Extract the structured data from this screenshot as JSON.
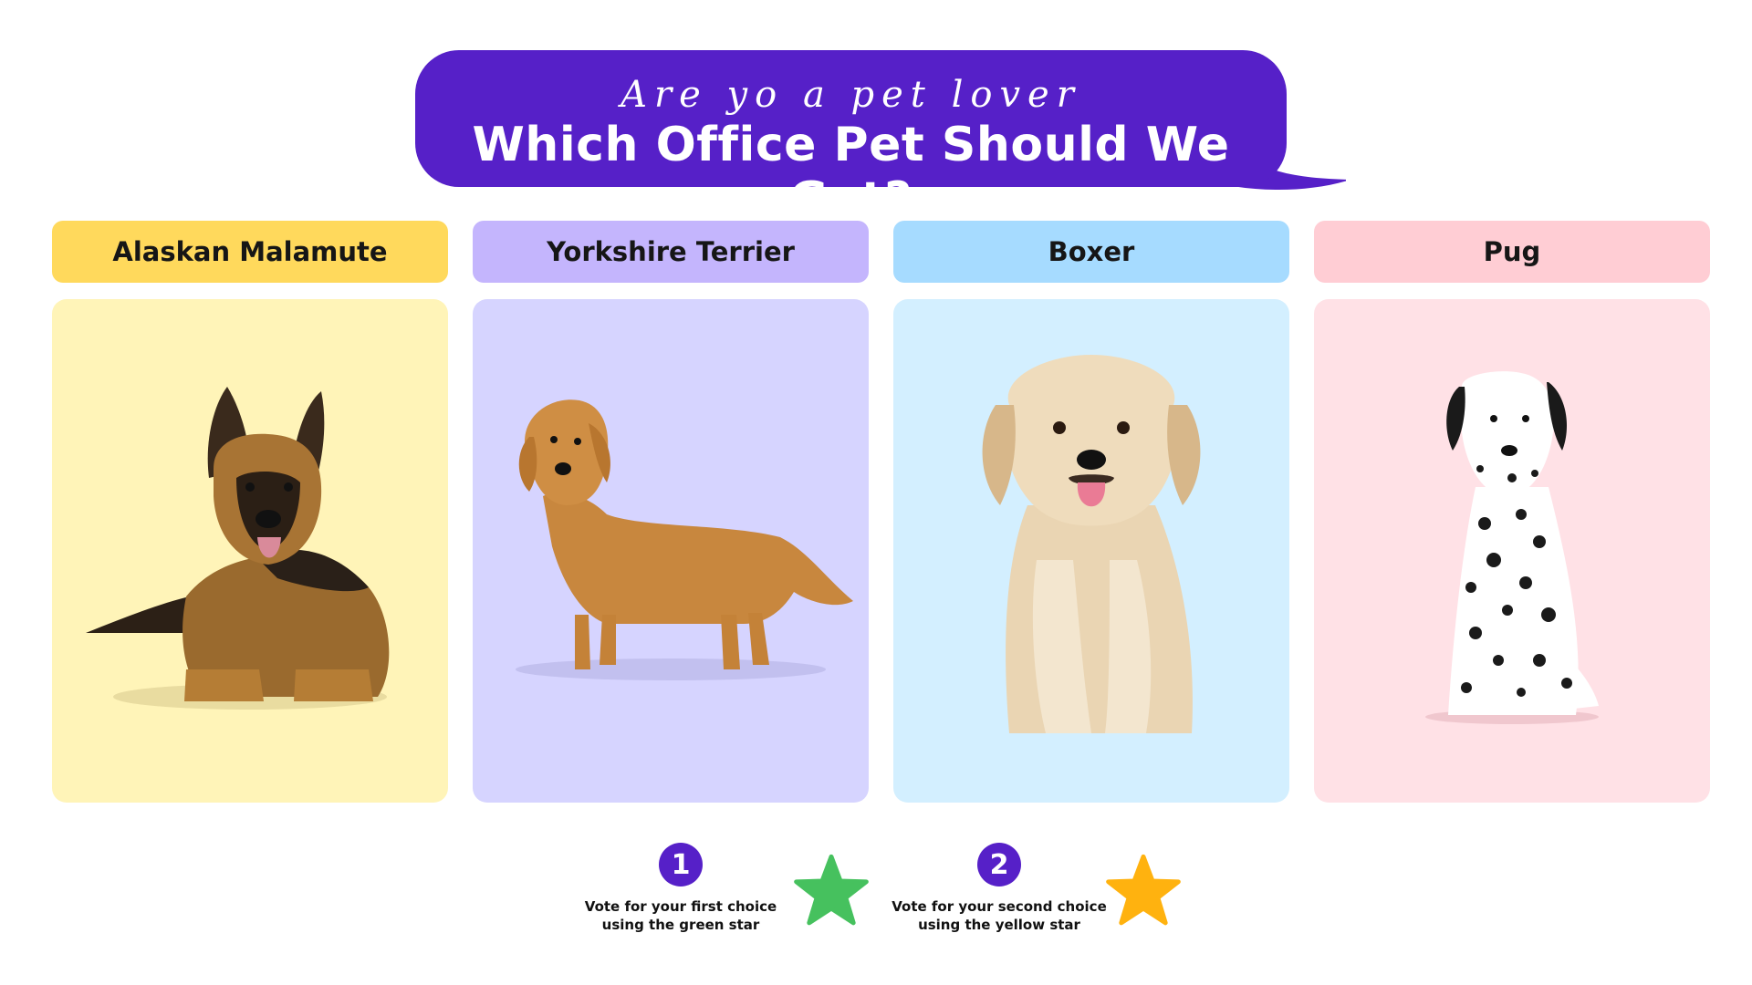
{
  "header": {
    "subtitle": "Are yo a pet lover",
    "title": "Which Office Pet Should We Get?"
  },
  "options": [
    {
      "label": "Alaskan Malamute",
      "image": "german-shepherd-lying",
      "pill_color": "#ffd95c",
      "card_color": "#fff4b8"
    },
    {
      "label": "Yorkshire Terrier",
      "image": "golden-retriever-standing",
      "pill_color": "#c4b5fd",
      "card_color": "#d6d4ff"
    },
    {
      "label": "Boxer",
      "image": "golden-retriever-sitting",
      "pill_color": "#a6dbff",
      "card_color": "#d3efff"
    },
    {
      "label": "Pug",
      "image": "dalmatian-sitting",
      "pill_color": "#ffcdd4",
      "card_color": "#ffe1e6"
    }
  ],
  "legend": [
    {
      "number": "1",
      "text": "Vote for your first choice using the green star",
      "star_color": "#46c15e",
      "icon": "green-star-icon"
    },
    {
      "number": "2",
      "text": "Vote for your second choice using the yellow star",
      "star_color": "#ffb20f",
      "icon": "yellow-star-icon"
    }
  ],
  "colors": {
    "accent": "#5620c8"
  }
}
